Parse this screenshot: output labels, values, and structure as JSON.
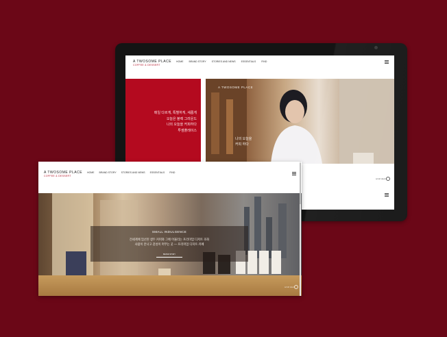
{
  "brand": {
    "name": "A TWOSOME PLACE",
    "tagline": "COFFEE & DESSERT"
  },
  "nav": [
    "HOME",
    "BRAND STORY",
    "STORIES AND NEWS",
    "ESSENTIALS",
    "FIND"
  ],
  "tablet": {
    "red_panel_lines": [
      "매일 다르게, 특별하게, 새롭게",
      "오늘은 블랙 그라운드",
      "나의 오늘을 커피하다",
      "투썸플레이스"
    ],
    "photo_logo": "A TWOSOME PLACE",
    "photo_caption_lines": [
      "나의 오늘을",
      "커피 하다"
    ],
    "footer_label": "scroll down"
  },
  "laptop": {
    "hero_title": "SMALL INDULGENCE",
    "hero_lines": [
      "전세계에 엄선된 생두 커피와 그에 어울리는 프리미엄 디저트 조화",
      "사람이 만나고 감성이 머무는 곳 — 프리미엄 디저트 카페"
    ],
    "hero_button": "BRAND STORY",
    "corner_label": "scroll down"
  },
  "colors": {
    "background": "#6b0717",
    "brand_red": "#b40a1f"
  }
}
